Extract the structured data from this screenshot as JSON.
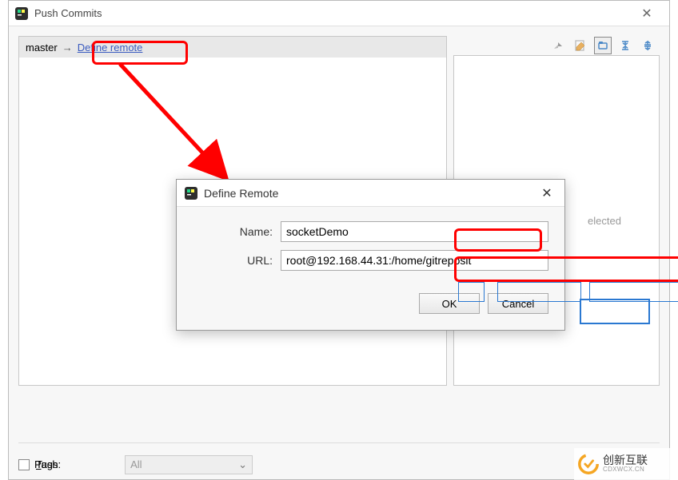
{
  "main": {
    "title": "Push Commits",
    "branch": "master",
    "define_remote_label": "Define remote",
    "right_placeholder": "elected",
    "push_tags_label": "Push Tags:",
    "tag_scope": "All"
  },
  "dialog": {
    "title": "Define Remote",
    "name_label": "Name:",
    "url_label": "URL:",
    "name_value": "socketDemo",
    "url_value": "root@192.168.44.31:/home/gitreposit",
    "ok_label": "OK",
    "cancel_label": "Cancel"
  },
  "watermark": {
    "cn": "创新互联",
    "en": "CDXWCX.CN"
  }
}
